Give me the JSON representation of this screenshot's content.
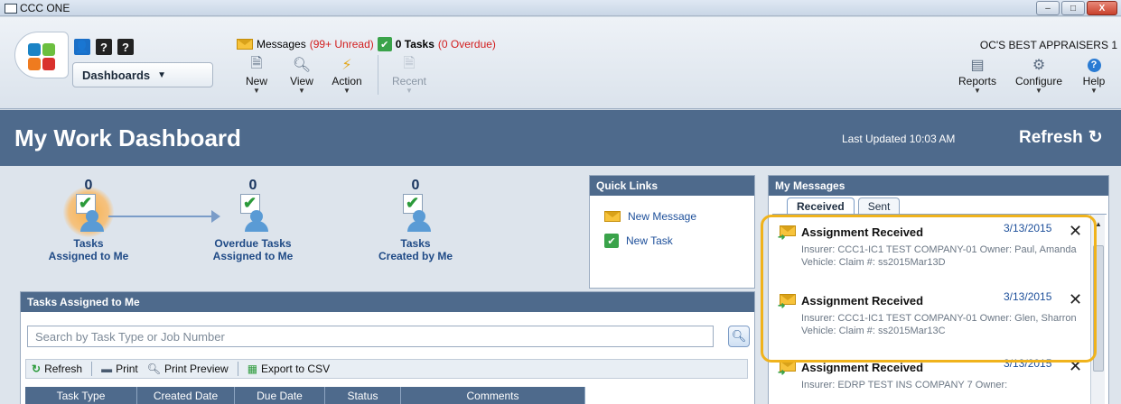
{
  "window": {
    "title": "CCC ONE",
    "buttons": {
      "minimize": "–",
      "maximize": "□",
      "close": "X"
    }
  },
  "toolbar": {
    "tab_icons": [
      "?",
      "?"
    ],
    "dashboards_label": "Dashboards",
    "messages_label": "Messages",
    "messages_unread": "(99+ Unread)",
    "tasks_count": "0 Tasks",
    "tasks_overdue": "(0 Overdue)",
    "company": "OC'S BEST APPRAISERS 1",
    "new_label": "New",
    "view_label": "View",
    "action_label": "Action",
    "recent_label": "Recent",
    "reports_label": "Reports",
    "configure_label": "Configure",
    "help_label": "Help"
  },
  "header": {
    "title": "My Work Dashboard",
    "last_updated": "Last Updated 10:03 AM",
    "refresh_label": "Refresh"
  },
  "metrics": [
    {
      "count": "0",
      "line1": "Tasks",
      "line2": "Assigned to Me"
    },
    {
      "count": "0",
      "line1": "Overdue Tasks",
      "line2": "Assigned to Me"
    },
    {
      "count": "0",
      "line1": "Tasks",
      "line2": "Created by Me"
    }
  ],
  "quick_links": {
    "title": "Quick Links",
    "new_message": "New Message",
    "new_task": "New Task"
  },
  "tasks_panel": {
    "title": "Tasks Assigned to Me",
    "search_placeholder": "Search by Task Type or Job Number",
    "refresh": "Refresh",
    "print": "Print",
    "print_preview": "Print Preview",
    "export_csv": "Export to CSV",
    "columns": [
      "Task Type",
      "Created Date",
      "Due Date",
      "Status",
      "Comments"
    ]
  },
  "messages_panel": {
    "title": "My Messages",
    "tab_received": "Received",
    "tab_sent": "Sent",
    "items": [
      {
        "subject": "Assignment Received",
        "date": "3/13/2015",
        "desc": "Insurer: CCC1-IC1 TEST COMPANY-01 Owner: Paul, Amanda Vehicle:  Claim #: ss2015Mar13D"
      },
      {
        "subject": "Assignment Received",
        "date": "3/13/2015",
        "desc": "Insurer: CCC1-IC1 TEST COMPANY-01 Owner: Glen, Sharron Vehicle:  Claim #: ss2015Mar13C"
      },
      {
        "subject": "Assignment Received",
        "date": "3/13/2015",
        "desc": "Insurer: EDRP TEST INS COMPANY 7 Owner:"
      }
    ]
  },
  "colors": {
    "accent": "#4e6a8c",
    "highlight": "#f0b31c",
    "link": "#1d4f9a",
    "unread": "#d21d1d"
  }
}
